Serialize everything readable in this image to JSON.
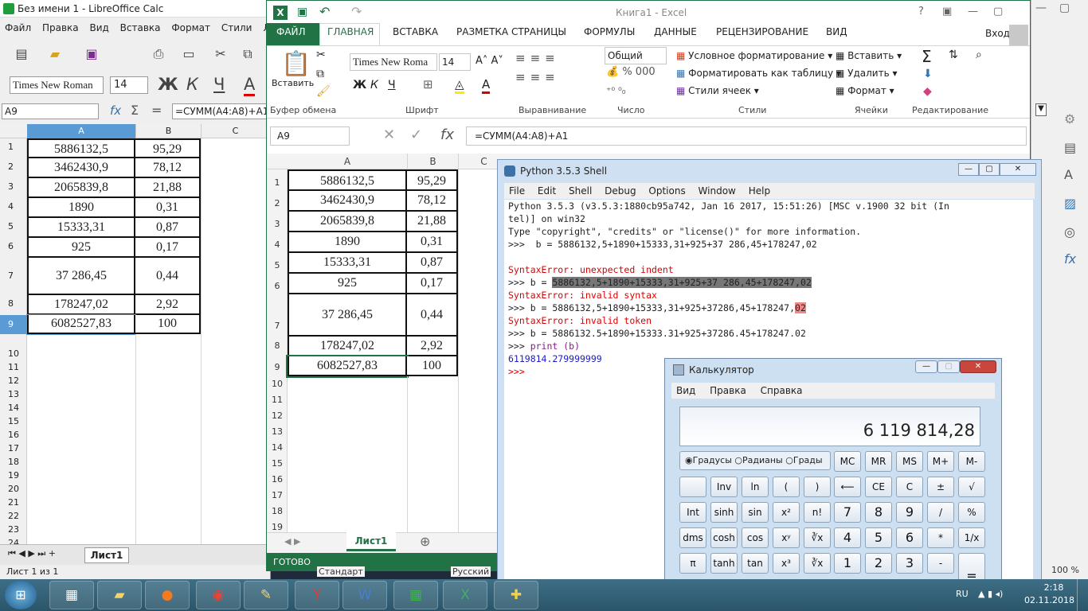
{
  "libreoffice": {
    "title": "Без имени 1 - LibreOffice Calc",
    "menu": [
      "Файл",
      "Правка",
      "Вид",
      "Вставка",
      "Формат",
      "Стили",
      "Лист"
    ],
    "font_name": "Times New Roman",
    "font_size": "14",
    "bold": "Ж",
    "italic": "К",
    "underline": "Ч",
    "name_box": "A9",
    "formula": "=СУММ(A4:A8)+A1",
    "fx": "fx",
    "sum": "Σ",
    "eq": "=",
    "columns": [
      "A",
      "B",
      "C"
    ],
    "rows": [
      {
        "n": "1",
        "a": "5886132,5",
        "b": "95,29"
      },
      {
        "n": "2",
        "a": "3462430,9",
        "b": "78,12"
      },
      {
        "n": "3",
        "a": "2065839,8",
        "b": "21,88"
      },
      {
        "n": "4",
        "a": "1890",
        "b": "0,31"
      },
      {
        "n": "5",
        "a": "15333,31",
        "b": "0,87"
      },
      {
        "n": "6",
        "a": "925",
        "b": "0,17"
      },
      {
        "n": "7",
        "a": "37 286,45",
        "b": "0,44"
      },
      {
        "n": "8",
        "a": "178247,02",
        "b": "2,92"
      },
      {
        "n": "9",
        "a": "6082527,83",
        "b": "100"
      }
    ],
    "empty_rows": [
      "10",
      "11",
      "12",
      "13",
      "14",
      "15",
      "16",
      "17",
      "18",
      "19",
      "20",
      "21",
      "22",
      "23",
      "24"
    ],
    "sheet_tab": "Лист1",
    "status": "Лист 1 из 1"
  },
  "excel": {
    "title": "Книга1 - Excel",
    "signin": "Вход",
    "tabs": [
      "ФАЙЛ",
      "ГЛАВНАЯ",
      "ВСТАВКА",
      "РАЗМЕТКА СТРАНИЦЫ",
      "ФОРМУЛЫ",
      "ДАННЫЕ",
      "РЕЦЕНЗИРОВАНИЕ",
      "ВИД"
    ],
    "paste": "Вставить",
    "font_name": "Times New Roma",
    "font_size": "14",
    "bold": "Ж",
    "italic": "К",
    "underline": "Ч",
    "number_format": "Общий",
    "cond_format": "Условное форматирование",
    "format_table": "Форматировать как таблицу",
    "cell_styles": "Стили ячеек",
    "insert": "Вставить",
    "delete": "Удалить",
    "format": "Формат",
    "groups": [
      "Буфер обмена",
      "Шрифт",
      "Выравнивание",
      "Число",
      "Стили",
      "Ячейки",
      "Редактирование"
    ],
    "name_box": "A9",
    "fx": "fx",
    "formula": "=СУММ(A4:A8)+A1",
    "columns": [
      "A",
      "B",
      "C"
    ],
    "rows": [
      {
        "n": "1",
        "a": "5886132,5",
        "b": "95,29"
      },
      {
        "n": "2",
        "a": "3462430,9",
        "b": "78,12"
      },
      {
        "n": "3",
        "a": "2065839,8",
        "b": "21,88"
      },
      {
        "n": "4",
        "a": "1890",
        "b": "0,31"
      },
      {
        "n": "5",
        "a": "15333,31",
        "b": "0,87"
      },
      {
        "n": "6",
        "a": "925",
        "b": "0,17"
      },
      {
        "n": "7",
        "a": "37 286,45",
        "b": "0,44"
      },
      {
        "n": "8",
        "a": "178247,02",
        "b": "2,92"
      },
      {
        "n": "9",
        "a": "6082527,83",
        "b": "100"
      }
    ],
    "empty_rows": [
      "10",
      "11",
      "12",
      "13",
      "14",
      "15",
      "16",
      "17",
      "18",
      "19"
    ],
    "sheet_tab": "Лист1",
    "status": "ГОТОВО",
    "zoom": "100 %"
  },
  "python": {
    "title": "Python 3.5.3 Shell",
    "menu": [
      "File",
      "Edit",
      "Shell",
      "Debug",
      "Options",
      "Window",
      "Help"
    ],
    "lines": {
      "l1": "Python 3.5.3 (v3.5.3:1880cb95a742, Jan 16 2017, 15:51:26) [MSC v.1900 32 bit (In",
      "l2": "tel)] on win32",
      "l3": "Type \"copyright\", \"credits\" or \"license()\" for more information.",
      "l4": ">>>  b = 5886132,5+1890+15333,31+925+37 286,45+178247,02",
      "l5": "SyntaxError: unexpected indent",
      "l6p": ">>> b = ",
      "l6h": "5886132,5+1890+15333,31+925+37 286,45+178247,02",
      "l7": "SyntaxError: invalid syntax",
      "l8p": ">>> b = 5886132,5+1890+15333,31+925+37286,45+178247,",
      "l8h": "02",
      "l9": "SyntaxError: invalid token",
      "l10": ">>> b = 5886132.5+1890+15333.31+925+37286.45+178247.02",
      "l11p": ">>> ",
      "l11": "print (b)",
      "l12": "6119814.279999999",
      "l13": ">>> "
    }
  },
  "calculator": {
    "title": "Калькулятор",
    "menu": [
      "Вид",
      "Правка",
      "Справка"
    ],
    "display": "6 119 814,28",
    "modes": [
      "Градусы",
      "Радианы",
      "Грады"
    ],
    "mem": [
      "MC",
      "MR",
      "MS",
      "M+",
      "M-"
    ],
    "row1": [
      "",
      "Inv",
      "ln",
      "(",
      ")",
      "⟵",
      "CE",
      "C",
      "±",
      "√"
    ],
    "row2": [
      "Int",
      "sinh",
      "sin",
      "x²",
      "n!",
      "7",
      "8",
      "9",
      "/",
      "%"
    ],
    "row3": [
      "dms",
      "cosh",
      "cos",
      "xʸ",
      "∛x",
      "4",
      "5",
      "6",
      "*",
      "1/x"
    ],
    "row4": [
      "π",
      "tanh",
      "tan",
      "x³",
      "∛x",
      "1",
      "2",
      "3",
      "-",
      "="
    ]
  },
  "excel_status_extra": {
    "standard": "Стандарт",
    "russian": "Русский"
  },
  "taskbar": {
    "lang": "RU",
    "time": "2:18",
    "date": "02.11.2018"
  },
  "colors": {
    "excel_green": "#217346",
    "lo_header": "#5a9bd5",
    "python_red": "#d00"
  }
}
